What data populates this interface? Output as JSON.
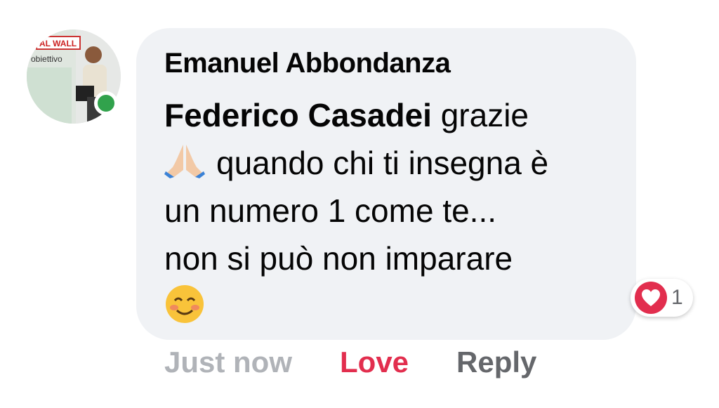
{
  "comment": {
    "author": "Emanuel Abbondanza",
    "mention": "Federico Casadei",
    "text_line1_rest": " grazie",
    "pray_emoji": "pray-emoji",
    "text_line2": "quando chi ti insegna è",
    "text_line3": "un numero 1 come te...",
    "text_line4": "non si può non imparare",
    "smile_emoji": "smiling-face-emoji",
    "avatar_icon": "profile-photo",
    "avatar_sign_text": "AL WALL",
    "avatar_board_text": "obiettivo",
    "online_status_color": "#31a24c"
  },
  "reaction": {
    "icon": "heart-icon",
    "count": "1",
    "color": "#e22e4e"
  },
  "actions": {
    "timestamp": "Just now",
    "love_label": "Love",
    "reply_label": "Reply"
  },
  "colors": {
    "bubble_bg": "#f0f2f5",
    "love": "#e22e4e",
    "reply": "#65676b",
    "timestamp": "#b0b3b8"
  }
}
